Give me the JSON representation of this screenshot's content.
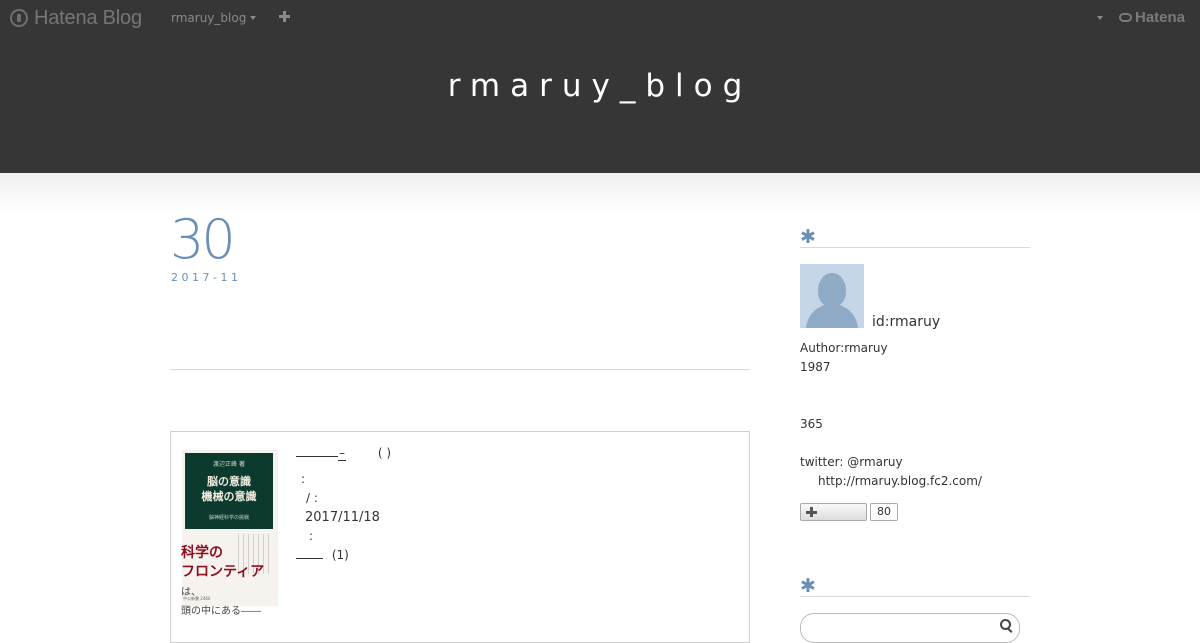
{
  "globalbar": {
    "logo_text": "Hatena Blog",
    "blog_switch_label": "rmaruy_blog",
    "brand_text": "Hatena"
  },
  "header": {
    "blog_title": "rmaruy_blog"
  },
  "entry": {
    "day": "30",
    "year_month": "2017-11"
  },
  "book": {
    "cover": {
      "author": "渡辺正峰 著",
      "title_line1": "脳の意識",
      "title_line2": "機械の意識",
      "subtitle": "脳神経科学の挑戦",
      "catch_line1": "科学の",
      "catch_line2": "フロンティア",
      "catch_suffix": "は、",
      "catch_line3": "頭の中にある――",
      "publisher": "中公新書 2460"
    },
    "title_dash": "–",
    "paren": "(   )",
    "colon1": ":",
    "slash_colon": "/    :",
    "date": "2017/11/18",
    "colon2": ":",
    "count": "(1)"
  },
  "sidebar": {
    "profile_heading_icon": "asterisk-icon",
    "profile_id": "id:rmaruy",
    "author": "Author:rmaruy",
    "year": "1987",
    "days": "365",
    "twitter": "twitter: @rmaruy",
    "url": "http://rmaruy.blog.fc2.com/",
    "follow_count": "80",
    "search_heading_icon": "asterisk-icon"
  },
  "colors": {
    "header_bg": "#363636",
    "accent": "#6a8fb7"
  }
}
